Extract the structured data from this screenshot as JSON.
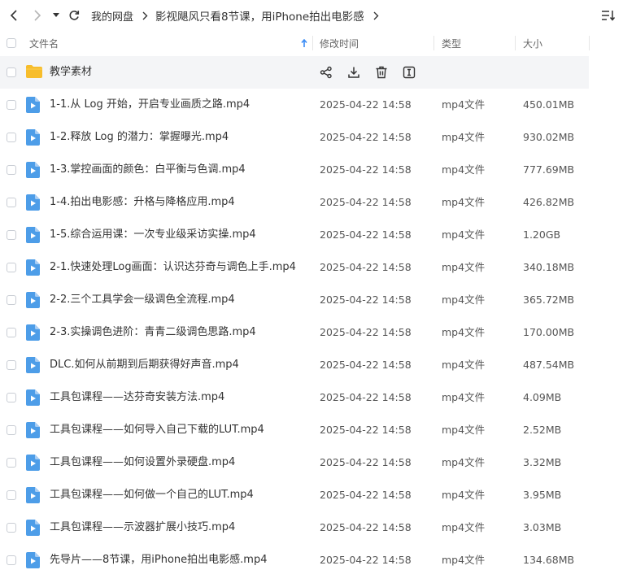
{
  "breadcrumb": {
    "root": "我的网盘",
    "current": "影视飓风只看8节课，用iPhone拍出电影感"
  },
  "columns": {
    "name": "文件名",
    "modified": "修改时间",
    "type": "类型",
    "size": "大小",
    "sort_icon": "sort-ascending-icon"
  },
  "folder": {
    "name": "教学素材",
    "icon": "folder-icon",
    "actions": [
      "share-icon",
      "download-icon",
      "delete-icon",
      "rename-icon"
    ]
  },
  "files": [
    {
      "name": "1-1.从 Log 开始，开启专业画质之路.mp4",
      "date": "2025-04-22 14:58",
      "type": "mp4文件",
      "size": "450.01MB"
    },
    {
      "name": "1-2.释放 Log 的潜力：掌握曝光.mp4",
      "date": "2025-04-22 14:58",
      "type": "mp4文件",
      "size": "930.02MB"
    },
    {
      "name": "1-3.掌控画面的颜色：白平衡与色调.mp4",
      "date": "2025-04-22 14:58",
      "type": "mp4文件",
      "size": "777.69MB"
    },
    {
      "name": "1-4.拍出电影感：升格与降格应用.mp4",
      "date": "2025-04-22 14:58",
      "type": "mp4文件",
      "size": "426.82MB"
    },
    {
      "name": "1-5.综合运用课：一次专业级采访实操.mp4",
      "date": "2025-04-22 14:58",
      "type": "mp4文件",
      "size": "1.20GB"
    },
    {
      "name": "2-1.快速处理Log画面：认识达芬奇与调色上手.mp4",
      "date": "2025-04-22 14:58",
      "type": "mp4文件",
      "size": "340.18MB"
    },
    {
      "name": "2-2.三个工具学会一级调色全流程.mp4",
      "date": "2025-04-22 14:58",
      "type": "mp4文件",
      "size": "365.72MB"
    },
    {
      "name": "2-3.实操调色进阶：青青二级调色思路.mp4",
      "date": "2025-04-22 14:58",
      "type": "mp4文件",
      "size": "170.00MB"
    },
    {
      "name": "DLC.如何从前期到后期获得好声音.mp4",
      "date": "2025-04-22 14:58",
      "type": "mp4文件",
      "size": "487.54MB"
    },
    {
      "name": "工具包课程——达芬奇安装方法.mp4",
      "date": "2025-04-22 14:58",
      "type": "mp4文件",
      "size": "4.09MB"
    },
    {
      "name": "工具包课程——如何导入自己下载的LUT.mp4",
      "date": "2025-04-22 14:58",
      "type": "mp4文件",
      "size": "2.52MB"
    },
    {
      "name": "工具包课程——如何设置外录硬盘.mp4",
      "date": "2025-04-22 14:58",
      "type": "mp4文件",
      "size": "3.32MB"
    },
    {
      "name": "工具包课程——如何做一个自己的LUT.mp4",
      "date": "2025-04-22 14:58",
      "type": "mp4文件",
      "size": "3.95MB"
    },
    {
      "name": "工具包课程——示波器扩展小技巧.mp4",
      "date": "2025-04-22 14:58",
      "type": "mp4文件",
      "size": "3.03MB"
    },
    {
      "name": "先导片——8节课，用iPhone拍出电影感.mp4",
      "date": "2025-04-22 14:58",
      "type": "mp4文件",
      "size": "134.68MB"
    }
  ],
  "colors": {
    "accent": "#3b8cf5",
    "folder": "#f7bd2b",
    "video_icon": "#4d9de8"
  }
}
